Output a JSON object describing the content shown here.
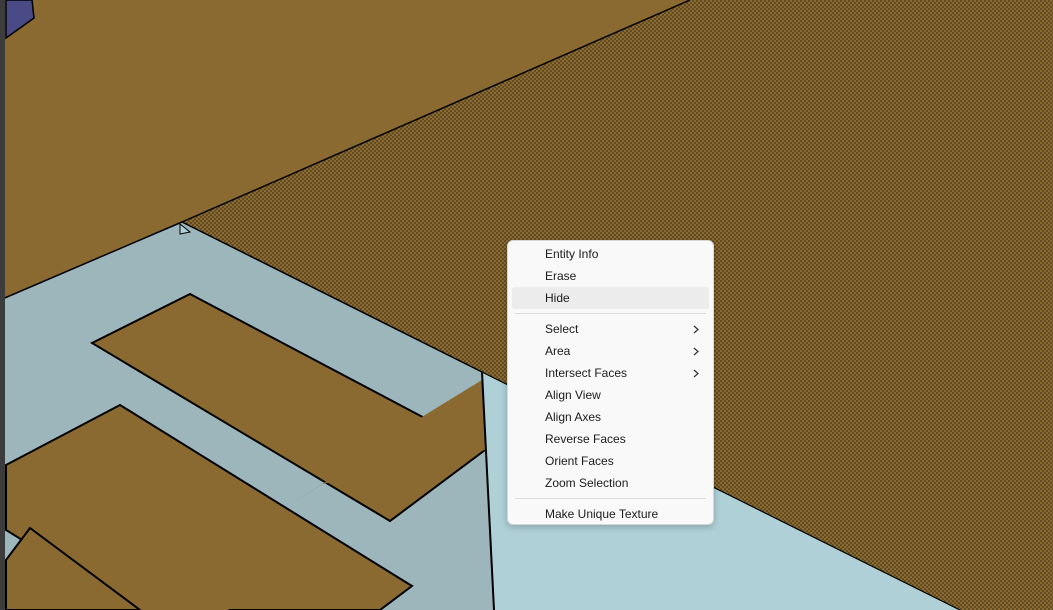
{
  "colors": {
    "ground": "#8a6a31",
    "ground_dotted": "#8a6a31",
    "floor_face": "#9db6bc",
    "floor_face_light": "#aed0d6",
    "purple_face": "#4a4a86",
    "edge": "#000000",
    "menu_background": "#f9f9f9",
    "menu_hover": "#ececec",
    "menu_text": "#1b1b1b"
  },
  "context_menu": {
    "groups": [
      [
        {
          "label": "Entity Info",
          "submenu": false,
          "hover": false
        },
        {
          "label": "Erase",
          "submenu": false,
          "hover": false
        },
        {
          "label": "Hide",
          "submenu": false,
          "hover": true
        }
      ],
      [
        {
          "label": "Select",
          "submenu": true,
          "hover": false
        },
        {
          "label": "Area",
          "submenu": true,
          "hover": false
        },
        {
          "label": "Intersect Faces",
          "submenu": true,
          "hover": false
        },
        {
          "label": "Align View",
          "submenu": false,
          "hover": false
        },
        {
          "label": "Align Axes",
          "submenu": false,
          "hover": false
        },
        {
          "label": "Reverse Faces",
          "submenu": false,
          "hover": false
        },
        {
          "label": "Orient Faces",
          "submenu": false,
          "hover": false
        },
        {
          "label": "Zoom Selection",
          "submenu": false,
          "hover": false
        }
      ],
      [
        {
          "label": "Make Unique Texture",
          "submenu": false,
          "hover": false
        }
      ]
    ],
    "submenu_icon": "chevron-right-icon"
  }
}
